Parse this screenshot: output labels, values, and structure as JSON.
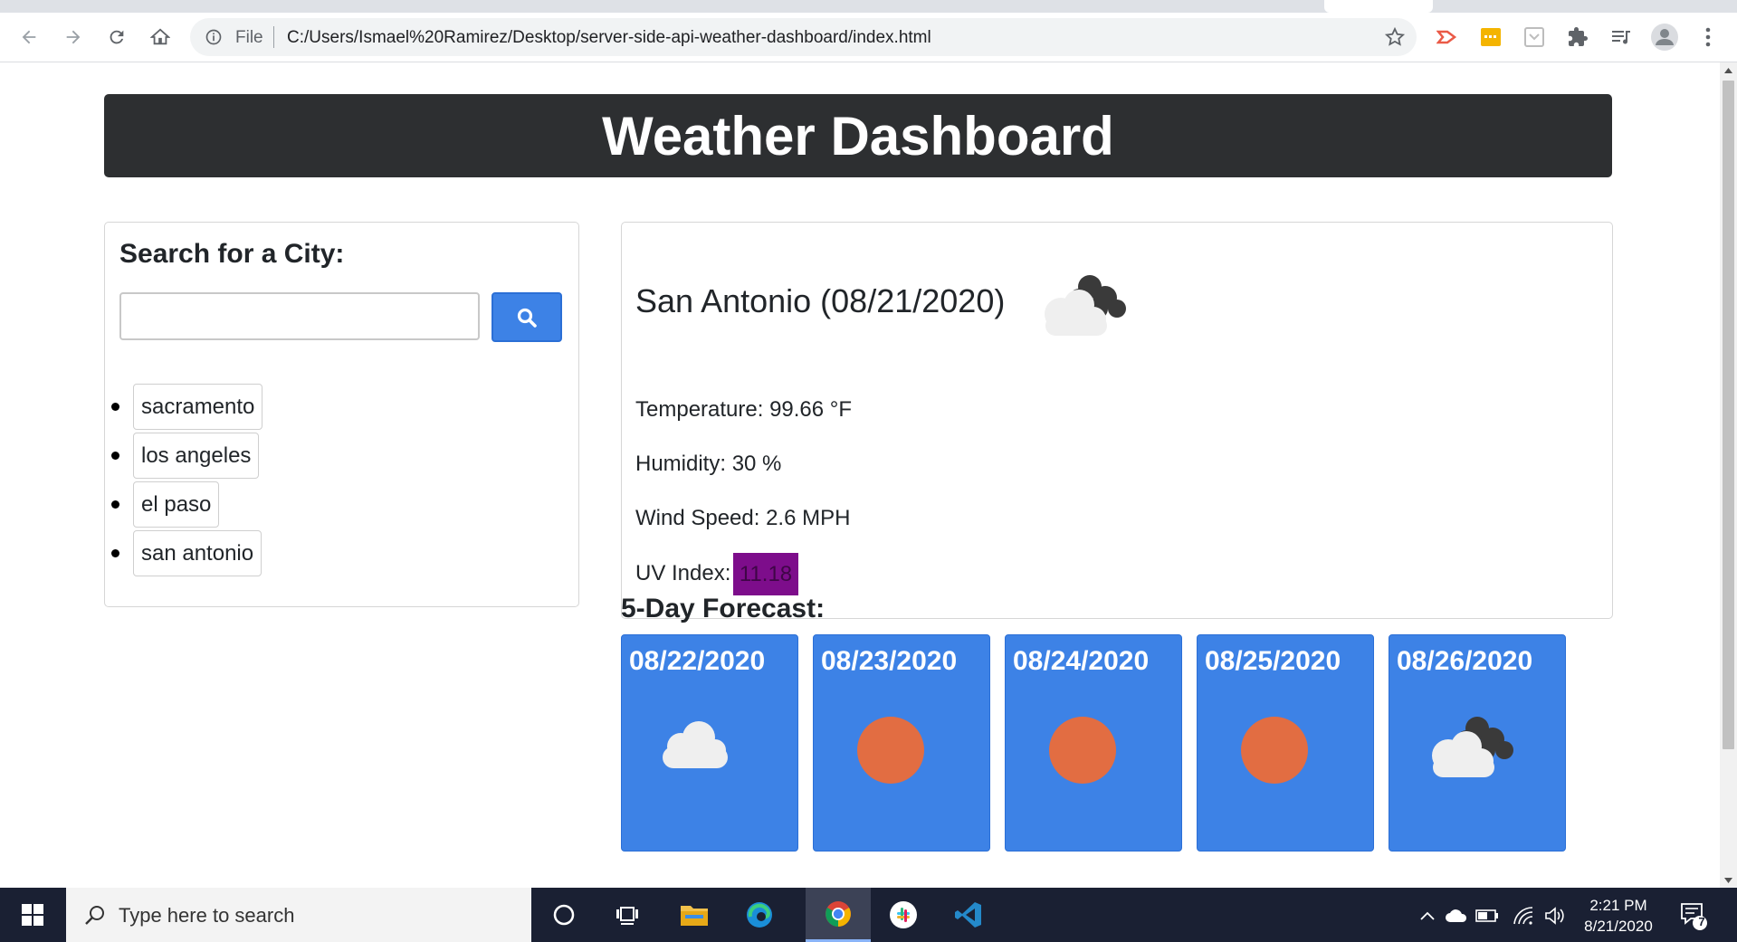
{
  "browser": {
    "address_scheme": "File",
    "url": "C:/Users/Ismael%20Ramirez/Desktop/server-side-api-weather-dashboard/index.html"
  },
  "page": {
    "header_title": "Weather Dashboard",
    "search": {
      "title": "Search for a City:",
      "input_value": "",
      "button_icon": "search-icon",
      "history": [
        "sacramento",
        "los angeles",
        "el paso",
        "san antonio"
      ]
    },
    "current": {
      "heading": "San Antonio (08/21/2020)",
      "icon": "broken-clouds-icon",
      "temperature": "Temperature: 99.66 °F",
      "humidity": "Humidity: 30 %",
      "wind": "Wind Speed: 2.6 MPH",
      "uv_label": "UV Index:",
      "uv_value": "11.18",
      "uv_color": "#7d0d8b"
    },
    "forecast": {
      "title": "5-Day Forecast:",
      "days": [
        {
          "date": "08/22/2020",
          "icon": "cloud-icon"
        },
        {
          "date": "08/23/2020",
          "icon": "sun-icon"
        },
        {
          "date": "08/24/2020",
          "icon": "sun-icon"
        },
        {
          "date": "08/25/2020",
          "icon": "sun-icon"
        },
        {
          "date": "08/26/2020",
          "icon": "broken-clouds-icon"
        }
      ]
    },
    "accent_color": "#3d82e6",
    "header_color": "#2d2f31"
  },
  "taskbar": {
    "search_placeholder": "Type here to search",
    "time": "2:21 PM",
    "date": "8/21/2020",
    "notification_count": "7"
  }
}
